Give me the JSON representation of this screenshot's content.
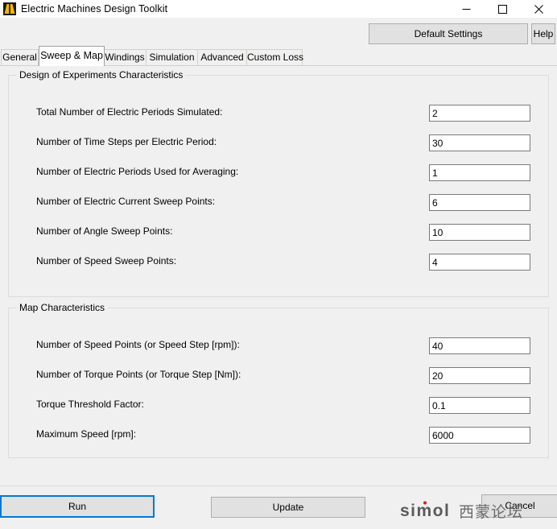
{
  "window": {
    "title": "Electric Machines Design Toolkit",
    "icon": "app-mountain-icon",
    "controls": {
      "minimize": "—",
      "maximize": "□",
      "close": "✕"
    }
  },
  "toolbar": {
    "default_settings_label": "Default Settings",
    "help_label": "Help"
  },
  "tabs": [
    {
      "label": "General",
      "active": false
    },
    {
      "label": "Sweep & Map",
      "active": true
    },
    {
      "label": "Windings",
      "active": false
    },
    {
      "label": "Simulation",
      "active": false
    },
    {
      "label": "Advanced",
      "active": false
    },
    {
      "label": "Custom Loss",
      "active": false
    }
  ],
  "groups": [
    {
      "title": "Design of Experiments Characteristics",
      "fields": [
        {
          "label": "Total Number of Electric Periods Simulated:",
          "value": "2"
        },
        {
          "label": "Number of Time Steps per Electric Period:",
          "value": "30"
        },
        {
          "label": "Number of Electric Periods Used for Averaging:",
          "value": "1"
        },
        {
          "label": "Number of Electric Current Sweep Points:",
          "value": "6"
        },
        {
          "label": "Number of Angle Sweep Points:",
          "value": "10"
        },
        {
          "label": "Number of Speed Sweep Points:",
          "value": "4"
        }
      ]
    },
    {
      "title": "Map Characteristics",
      "fields": [
        {
          "label": "Number of Speed Points (or Speed Step [rpm]):",
          "value": "40"
        },
        {
          "label": "Number of Torque Points (or Torque Step [Nm]):",
          "value": "20"
        },
        {
          "label": "Torque Threshold Factor:",
          "value": "0.1"
        },
        {
          "label": "Maximum Speed [rpm]:",
          "value": "6000"
        }
      ]
    }
  ],
  "footer": {
    "run_label": "Run",
    "update_label": "Update",
    "cancel_label": "Cancel"
  },
  "watermark": {
    "latin": "simol",
    "cjk": "西蒙论坛"
  },
  "colors": {
    "window_bg": "#f0f0f0",
    "titlebar_bg": "#ffffff",
    "focus_blue": "#0078d7",
    "button_face": "#e1e1e1",
    "button_border": "#adadad",
    "field_border": "#7a7a7a",
    "icon_gold": "#f2b705"
  }
}
